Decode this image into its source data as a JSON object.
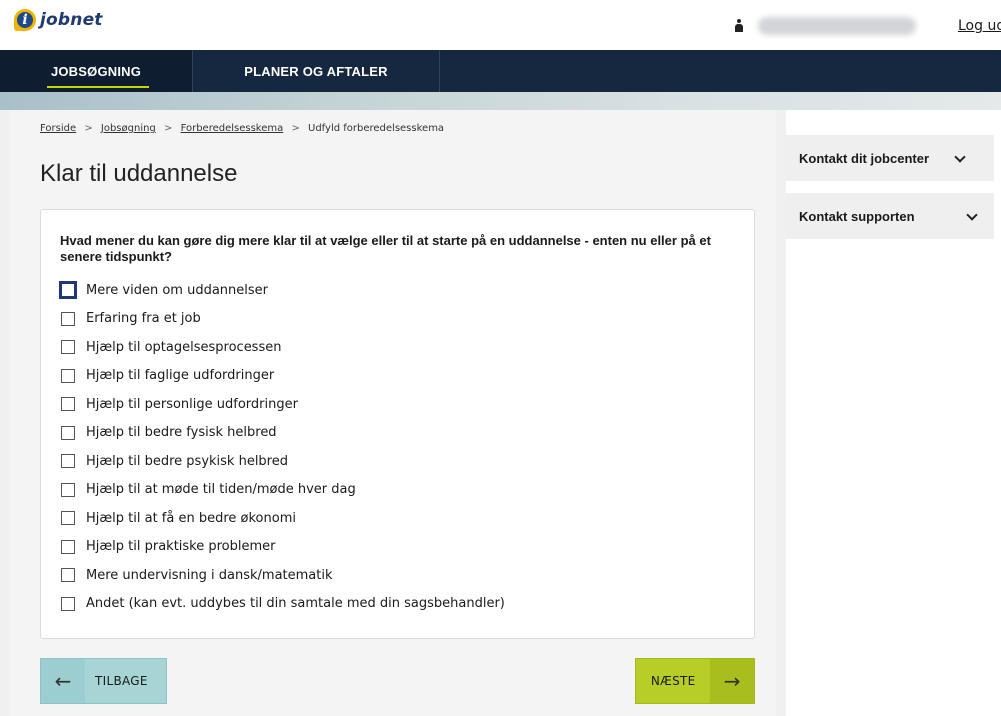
{
  "header": {
    "logo_letter": "i",
    "logo_text": "jobnet",
    "logout_label": "Log ud"
  },
  "nav": {
    "tabs": [
      {
        "label": "JOBSØGNING",
        "active": true
      },
      {
        "label": "PLANER OG AFTALER",
        "active": false
      }
    ]
  },
  "breadcrumb": {
    "items": [
      "Forside",
      "Jobsøgning",
      "Forberedelsesskema",
      "Udfyld forberedelsesskema"
    ],
    "separator": ">"
  },
  "page": {
    "title": "Klar til uddannelse"
  },
  "form": {
    "question": "Hvad mener du kan gøre dig mere klar til at vælge eller til at starte på en uddannelse - enten nu eller på et senere tidspunkt?",
    "options": [
      "Mere viden om uddannelser",
      "Erfaring fra et job",
      "Hjælp til optagelsesprocessen",
      "Hjælp til faglige udfordringer",
      "Hjælp til personlige udfordringer",
      "Hjælp til bedre fysisk helbred",
      "Hjælp til bedre psykisk helbred",
      "Hjælp til at møde til tiden/møde hver dag",
      "Hjælp til at få en bedre økonomi",
      "Hjælp til praktiske problemer",
      "Mere undervisning i dansk/matematik",
      "Andet (kan evt. uddybes til din samtale med din sagsbehandler)"
    ]
  },
  "buttons": {
    "back_label": "TILBAGE",
    "next_label": "NÆSTE",
    "back_arrow": "←",
    "next_arrow": "→"
  },
  "sidebar": {
    "items": [
      "Kontakt dit jobcenter",
      "Kontakt supporten"
    ]
  },
  "colors": {
    "nav_bg": "#16283f",
    "accent_underline": "#c7d600",
    "next_button": "#b7cd28",
    "back_button": "#a7d5d6"
  },
  "icons": {
    "logo": "jobnet-logo-icon",
    "user": "user-icon",
    "back": "arrow-left-icon",
    "next": "arrow-right-icon",
    "expand": "chevron-down-icon"
  }
}
